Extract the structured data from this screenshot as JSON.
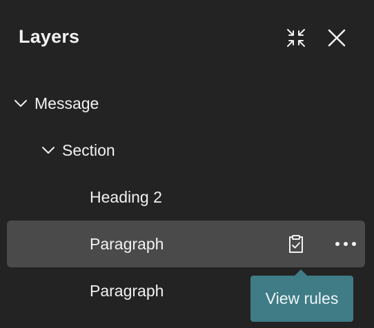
{
  "panel": {
    "title": "Layers",
    "actions": {
      "collapse_icon": "collapse-arrows-icon",
      "close_icon": "close-icon"
    }
  },
  "tree": {
    "items": [
      {
        "label": "Message",
        "level": 0,
        "expanded": true
      },
      {
        "label": "Section",
        "level": 1,
        "expanded": true
      },
      {
        "label": "Heading 2",
        "level": 2
      },
      {
        "label": "Paragraph",
        "level": 2,
        "selected": true
      },
      {
        "label": "Paragraph",
        "level": 2
      }
    ]
  },
  "row_actions": {
    "rules_icon": "clipboard-check-icon",
    "more_icon": "more-horizontal-icon"
  },
  "tooltip": {
    "text": "View rules"
  },
  "colors": {
    "background": "#232323",
    "selected_row": "#4a4a4a",
    "tooltip": "#3f7c86",
    "text": "#f2f2f2"
  }
}
